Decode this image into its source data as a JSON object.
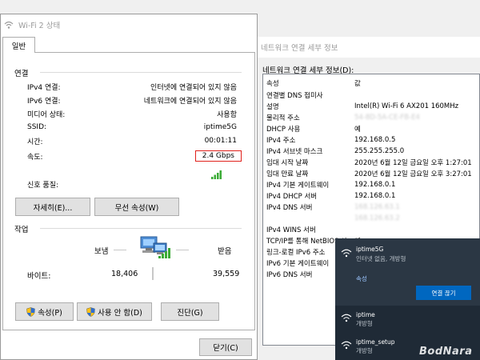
{
  "wifi_window": {
    "title": "Wi-Fi 2 상태",
    "tab": "일반",
    "connection": {
      "section": "연결",
      "rows": [
        {
          "label": "IPv4 연결:",
          "value": "인터넷에 연결되어 있지 않음"
        },
        {
          "label": "IPv6 연결:",
          "value": "네트워크에 연결되어 있지 않음"
        },
        {
          "label": "미디어 상태:",
          "value": "사용함"
        },
        {
          "label": "SSID:",
          "value": "iptime5G"
        },
        {
          "label": "시간:",
          "value": "00:01:11"
        },
        {
          "label": "속도:",
          "value": "2.4 Gbps"
        }
      ],
      "signal_label": "신호 품질:",
      "signal_bars": 4
    },
    "buttons": {
      "details": "자세히(E)...",
      "wireless_props": "무선 속성(W)"
    },
    "activity": {
      "section": "작업",
      "sent_label": "보냄",
      "recv_label": "받음",
      "bytes_label": "바이트:",
      "sent_value": "18,406",
      "recv_value": "39,559"
    },
    "bottom_buttons": {
      "properties": "속성(P)",
      "disable": "사용 안 함(D)",
      "diagnose": "진단(G)"
    },
    "close": "닫기(C)"
  },
  "details_window": {
    "title": "네트워크 연결 세부 정보",
    "label": "네트워크 연결 세부 정보(D):",
    "rows": [
      {
        "p": "속성",
        "v": "값"
      },
      {
        "p": "연결별 DNS 접미사",
        "v": ""
      },
      {
        "p": "설명",
        "v": "Intel(R) Wi-Fi 6 AX201 160MHz"
      },
      {
        "p": "물리적 주소",
        "v": "54-8D-5A-CE-FB-E4",
        "blur": true
      },
      {
        "p": "DHCP 사용",
        "v": "예"
      },
      {
        "p": "IPv4 주소",
        "v": "192.168.0.5"
      },
      {
        "p": "IPv4 서브넷 마스크",
        "v": "255.255.255.0"
      },
      {
        "p": "임대 시작 날짜",
        "v": "2020년 6월 12일 금요일 오후 1:27:01"
      },
      {
        "p": "임대 만료 날짜",
        "v": "2020년 6월 12일 금요일 오후 3:27:01"
      },
      {
        "p": "IPv4 기본 게이트웨이",
        "v": "192.168.0.1"
      },
      {
        "p": "IPv4 DHCP 서버",
        "v": "192.168.0.1"
      },
      {
        "p": "IPv4 DNS 서버",
        "v": "168.126.63.1",
        "blur": true
      },
      {
        "p": "",
        "v": "168.126.63.2",
        "blur": true
      },
      {
        "p": "IPv4 WINS 서버",
        "v": ""
      },
      {
        "p": "TCP/IP를 통해 NetBIOS 사...",
        "v": "예"
      },
      {
        "p": "링크-로컬 IPv6 주소",
        "v": ""
      },
      {
        "p": "IPv6 기본 게이트웨이",
        "v": ""
      },
      {
        "p": "IPv6 DNS 서버",
        "v": ""
      }
    ]
  },
  "flyout": {
    "networks": [
      {
        "name": "iptime5G",
        "sub": "인터넷 없음, 개방형",
        "link": "속성",
        "button": "연결 끊기"
      },
      {
        "name": "iptime",
        "sub": "개방형"
      },
      {
        "name": "iptime_setup",
        "sub": "개방형"
      }
    ],
    "watermark": "BodNara"
  }
}
